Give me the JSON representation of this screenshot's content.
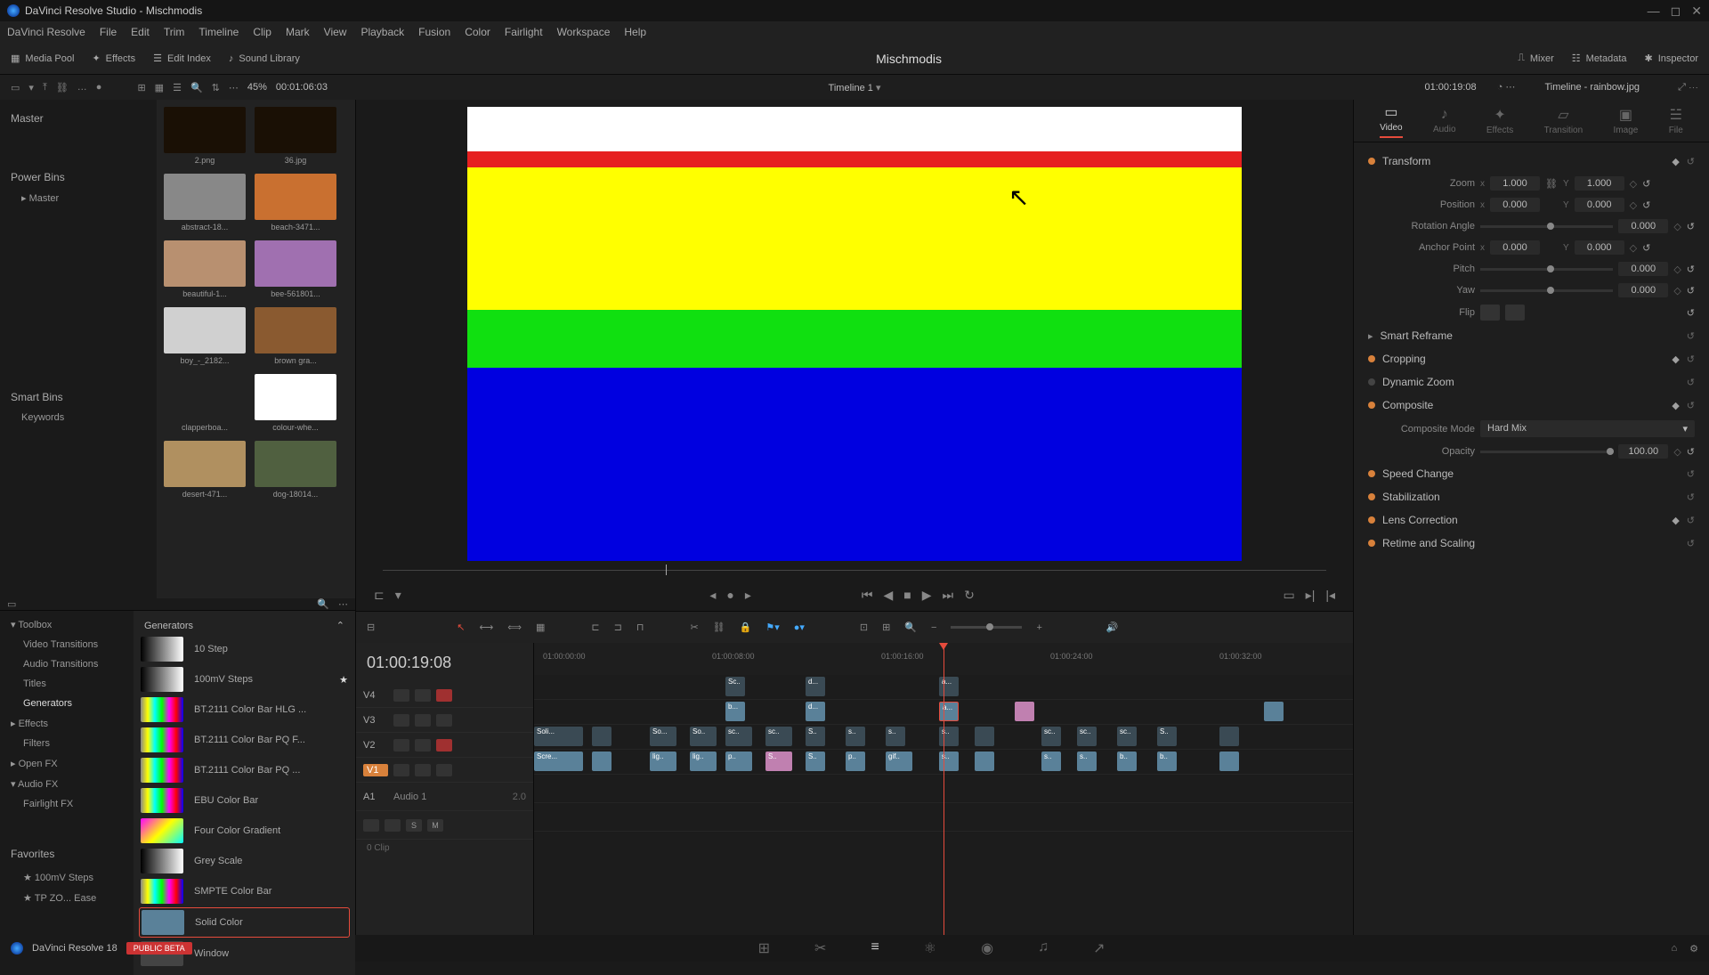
{
  "window": {
    "title": "DaVinci Resolve Studio - Mischmodis"
  },
  "menu": [
    "DaVinci Resolve",
    "File",
    "Edit",
    "Trim",
    "Timeline",
    "Clip",
    "Mark",
    "View",
    "Playback",
    "Fusion",
    "Color",
    "Fairlight",
    "Workspace",
    "Help"
  ],
  "toolbar": {
    "mediaPool": "Media Pool",
    "effects": "Effects",
    "editIndex": "Edit Index",
    "soundLibrary": "Sound Library",
    "project": "Mischmodis",
    "mixer": "Mixer",
    "metadata": "Metadata",
    "inspector": "Inspector"
  },
  "secondbar": {
    "zoom": "45%",
    "tc": "00:01:06:03",
    "timeline": "Timeline 1",
    "tlTc": "01:00:19:08",
    "clipName": "Timeline - rainbow.jpg"
  },
  "bins": {
    "master": "Master",
    "powerBins": "Power Bins",
    "powerMaster": "Master",
    "smartBins": "Smart Bins",
    "keywords": "Keywords"
  },
  "media": [
    {
      "name": "2.png",
      "bg": "#1a1005"
    },
    {
      "name": "36.jpg",
      "bg": "#1a1005"
    },
    {
      "name": "abstract-18...",
      "bg": "#888"
    },
    {
      "name": "beach-3471...",
      "bg": "#c97030"
    },
    {
      "name": "beautiful-1...",
      "bg": "#b89070"
    },
    {
      "name": "bee-561801...",
      "bg": "#a070b0"
    },
    {
      "name": "boy_-_2182...",
      "bg": "#d0d0d0"
    },
    {
      "name": "brown gra...",
      "bg": "#8a5a30"
    },
    {
      "name": "clapperboa...",
      "bg": "#222"
    },
    {
      "name": "colour-whe...",
      "bg": "#fff"
    },
    {
      "name": "desert-471...",
      "bg": "#b09060"
    },
    {
      "name": "dog-18014...",
      "bg": "#506040"
    }
  ],
  "fxTree": {
    "toolbox": "Toolbox",
    "vidTrans": "Video Transitions",
    "audTrans": "Audio Transitions",
    "titles": "Titles",
    "generators": "Generators",
    "effects": "Effects",
    "filters": "Filters",
    "openfx": "Open FX",
    "audiofx": "Audio FX",
    "fairlight": "Fairlight FX",
    "favorites": "Favorites",
    "fav1": "100mV Steps",
    "fav2": "TP ZO... Ease"
  },
  "fxList": {
    "header": "Generators",
    "items": [
      {
        "name": "10 Step",
        "sw": "linear-gradient(to right,#000,#fff)"
      },
      {
        "name": "100mV Steps",
        "sw": "linear-gradient(to right,#000,#fff)",
        "fav": true
      },
      {
        "name": "BT.2111 Color Bar HLG ...",
        "sw": "linear-gradient(to right,#888,#ff0,#0ff,#0f0,#f0f,#f00,#00f)"
      },
      {
        "name": "BT.2111 Color Bar PQ F...",
        "sw": "linear-gradient(to right,#888,#ff0,#0ff,#0f0,#f0f,#f00,#00f)"
      },
      {
        "name": "BT.2111 Color Bar PQ ...",
        "sw": "linear-gradient(to right,#888,#ff0,#0ff,#0f0,#f0f,#f00,#00f)"
      },
      {
        "name": "EBU Color Bar",
        "sw": "linear-gradient(to right,#888,#ff0,#0ff,#0f0,#f0f,#f00,#00f)"
      },
      {
        "name": "Four Color Gradient",
        "sw": "linear-gradient(135deg,#f0f,#ff0,#0ff)"
      },
      {
        "name": "Grey Scale",
        "sw": "linear-gradient(to right,#000,#fff)"
      },
      {
        "name": "SMPTE Color Bar",
        "sw": "linear-gradient(to right,#888,#ff0,#0ff,#0f0,#f0f,#f00,#00f)"
      },
      {
        "name": "Solid Color",
        "sw": "#5a8199",
        "sel": true
      },
      {
        "name": "Window",
        "sw": "#444"
      }
    ]
  },
  "timeline": {
    "tc": "01:00:19:08",
    "ticks": [
      "01:00:00:00",
      "01:00:08:00",
      "01:00:16:00",
      "01:00:24:00",
      "01:00:32:00"
    ],
    "tracks": {
      "v4": "V4",
      "v3": "V3",
      "v2": "V2",
      "v1": "V1",
      "a1": "A1",
      "a1name": "Audio 1",
      "a1ch": "2.0",
      "clip0": "0 Clip"
    }
  },
  "inspector": {
    "tabs": {
      "video": "Video",
      "audio": "Audio",
      "effects": "Effects",
      "transition": "Transition",
      "image": "Image",
      "file": "File"
    },
    "transform": "Transform",
    "zoom": "Zoom",
    "zoomX": "1.000",
    "zoomY": "1.000",
    "position": "Position",
    "posX": "0.000",
    "posY": "0.000",
    "rotation": "Rotation Angle",
    "rotVal": "0.000",
    "anchor": "Anchor Point",
    "anchX": "0.000",
    "anchY": "0.000",
    "pitch": "Pitch",
    "pitchVal": "0.000",
    "yaw": "Yaw",
    "yawVal": "0.000",
    "flip": "Flip",
    "smartReframe": "Smart Reframe",
    "cropping": "Cropping",
    "dynZoom": "Dynamic Zoom",
    "composite": "Composite",
    "compMode": "Composite Mode",
    "compModeVal": "Hard Mix",
    "opacity": "Opacity",
    "opacityVal": "100.00",
    "speed": "Speed Change",
    "stab": "Stabilization",
    "lens": "Lens Correction",
    "retime": "Retime and Scaling"
  },
  "bottom": {
    "app": "DaVinci Resolve 18",
    "beta": "PUBLIC BETA"
  }
}
